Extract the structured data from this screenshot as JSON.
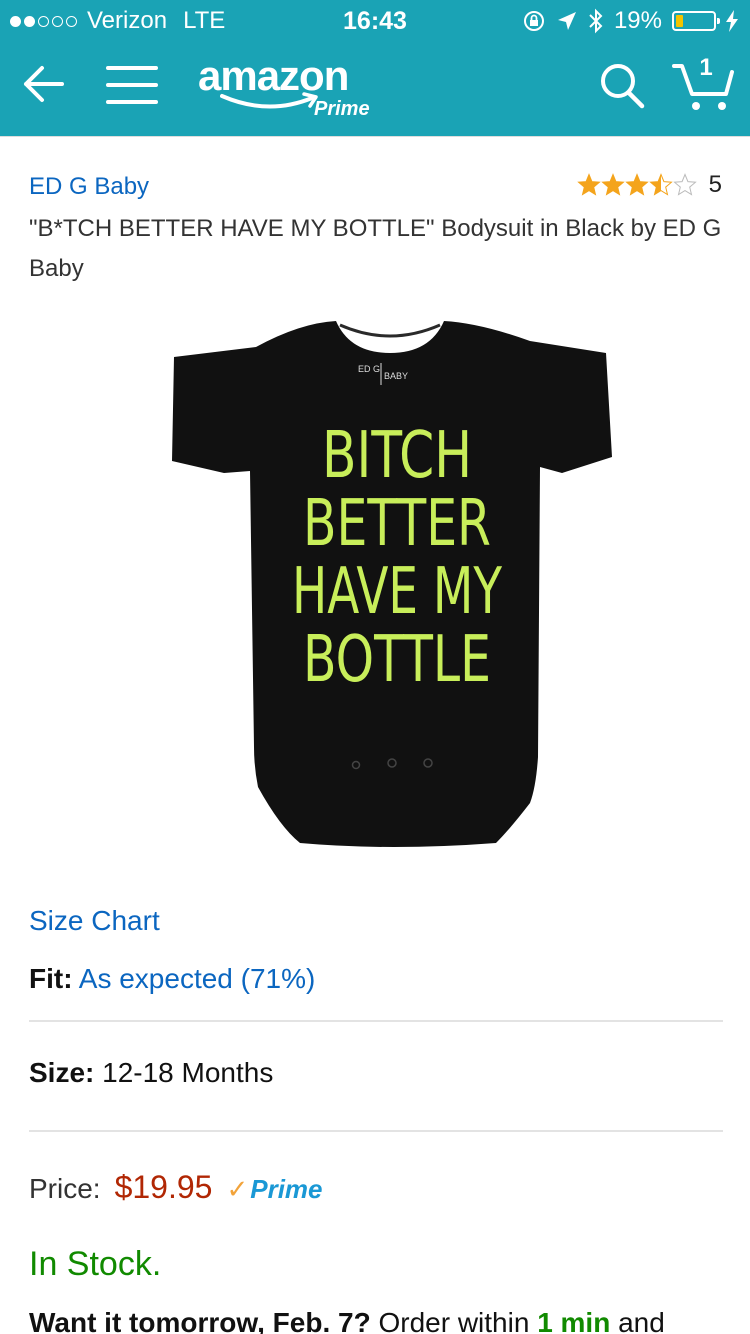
{
  "status_bar": {
    "carrier": "Verizon",
    "network": "LTE",
    "time": "16:43",
    "battery_percent": "19%",
    "battery_level": 0.19,
    "signal_bars_filled": 2,
    "signal_bars_total": 5,
    "icons": [
      "rotation-lock-icon",
      "location-arrow-icon",
      "bluetooth-icon",
      "charging-bolt-icon"
    ]
  },
  "header": {
    "background": "#1aa3b5",
    "logo_word": "amazon",
    "logo_sub": "Prime",
    "cart_count": "1"
  },
  "product": {
    "brand": "ED G Baby",
    "rating": 3.5,
    "rating_count": "5",
    "title": "\"B*TCH BETTER HAVE MY BOTTLE\" Bodysuit in Black by ED G Baby",
    "image": {
      "label_left": "ED G",
      "label_right": "BABY",
      "print_lines": [
        "BITCH",
        "BETTER",
        "HAVE MY",
        "BOTTLE"
      ]
    },
    "size_chart_label": "Size Chart",
    "fit_label": "Fit:",
    "fit_value": "As expected (71%)",
    "size_label": "Size:",
    "size_value": "12-18 Months",
    "price_label": "Price:",
    "price_value": "$19.95",
    "prime_label": "Prime",
    "stock": "In Stock.",
    "delivery": {
      "lead": "Want it tomorrow, Feb. 7?",
      "mid": " Order within ",
      "time": "1 min",
      "tail": " and"
    }
  },
  "colors": {
    "link": "#0b66c0",
    "price": "#b12704",
    "stock": "#118a00",
    "star": "#f4a41c",
    "print": "#c8ee5a"
  }
}
